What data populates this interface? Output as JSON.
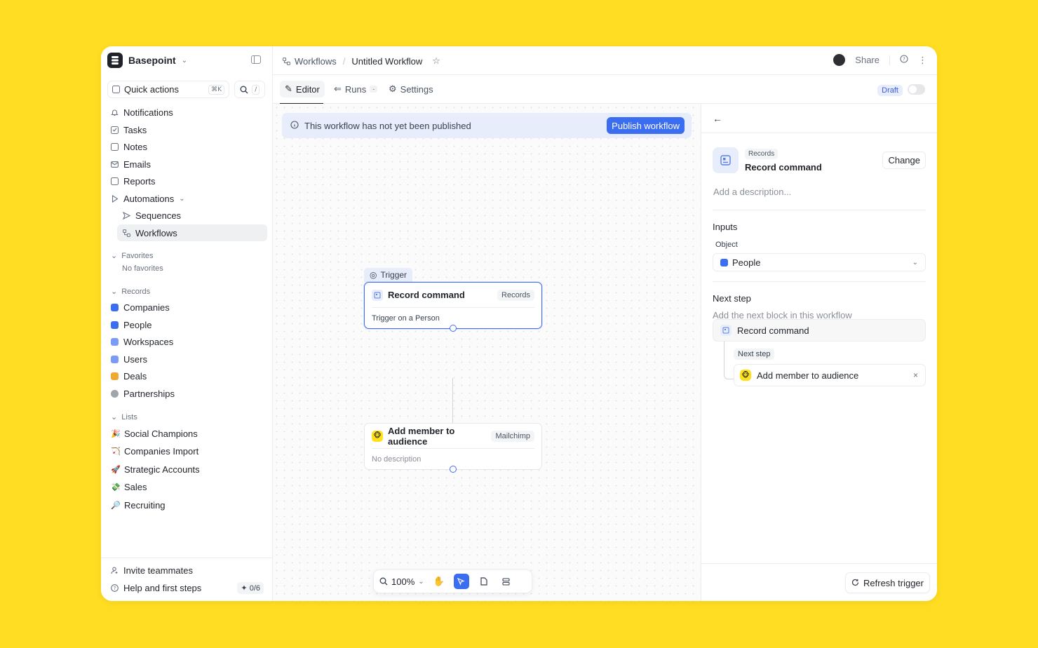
{
  "workspace": {
    "name": "Basepoint"
  },
  "quick_actions": {
    "label": "Quick actions",
    "shortcut": "⌘K",
    "slash": "/"
  },
  "nav": {
    "notifications": "Notifications",
    "tasks": "Tasks",
    "notes": "Notes",
    "emails": "Emails",
    "reports": "Reports",
    "automations": "Automations",
    "sequences": "Sequences",
    "workflows": "Workflows"
  },
  "favorites": {
    "title": "Favorites",
    "empty": "No favorites"
  },
  "records": {
    "title": "Records",
    "items": [
      "Companies",
      "People",
      "Workspaces",
      "Users",
      "Deals",
      "Partnerships"
    ],
    "colors": [
      "#3b6df0",
      "#3b6df0",
      "#7b9cf5",
      "#7b9cf5",
      "#f0a830",
      "#a0a4ab"
    ]
  },
  "lists": {
    "title": "Lists",
    "items": [
      "Social Champions",
      "Companies Import",
      "Strategic Accounts",
      "Sales",
      "Recruiting"
    ],
    "emojis": [
      "🎉",
      "🏹",
      "🚀",
      "💸",
      "🔎"
    ]
  },
  "footer": {
    "invite": "Invite teammates",
    "help": "Help and first steps",
    "progress": "0/6"
  },
  "breadcrumb": {
    "parent": "Workflows",
    "current": "Untitled Workflow"
  },
  "topbar": {
    "share": "Share"
  },
  "tabs": {
    "editor": "Editor",
    "runs": "Runs",
    "runs_badge": "-",
    "settings": "Settings"
  },
  "status": {
    "draft": "Draft"
  },
  "banner": {
    "text": "This workflow has not yet been published",
    "button": "Publish workflow"
  },
  "canvas": {
    "trigger_tag": "Trigger",
    "node1": {
      "title": "Record command",
      "badge": "Records",
      "body": "Trigger on a Person"
    },
    "node2": {
      "title": "Add member to audience",
      "badge": "Mailchimp",
      "body": "No description"
    }
  },
  "toolbar": {
    "zoom": "100%"
  },
  "panel": {
    "category": "Records",
    "title": "Record command",
    "change": "Change",
    "description_placeholder": "Add a description...",
    "inputs_title": "Inputs",
    "object_label": "Object",
    "object_value": "People",
    "next_step_title": "Next step",
    "next_step_sub": "Add the next block in this workflow",
    "step_name": "Record command",
    "child_tag": "Next step",
    "child_name": "Add member to audience",
    "refresh": "Refresh trigger"
  },
  "colors": {
    "accent": "#3b6df0",
    "background": "#FFDD22",
    "mailchimp": "#ffe01b"
  }
}
